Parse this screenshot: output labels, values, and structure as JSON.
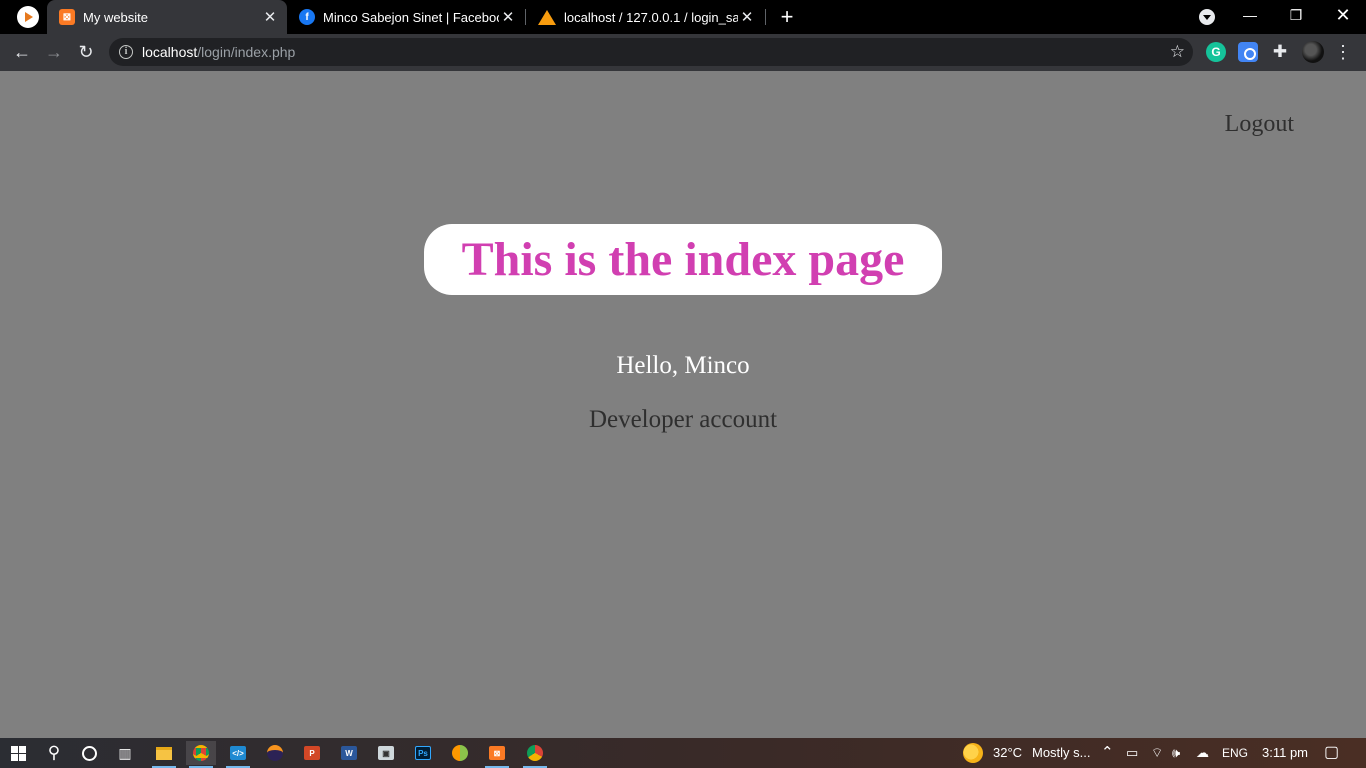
{
  "browser": {
    "tabs": [
      {
        "title": "My website",
        "favicon": "xampp-icon",
        "active": true
      },
      {
        "title": "Minco Sabejon Sinet | Facebook",
        "favicon": "facebook-icon",
        "active": false
      },
      {
        "title": "localhost / 127.0.0.1 / login_samp",
        "favicon": "phpmyadmin-icon",
        "active": false
      }
    ],
    "new_tab": "+",
    "address_bar": {
      "host": "localhost",
      "path": "/login/index.php"
    },
    "extensions": [
      "grammarly-icon",
      "screen-capture-icon",
      "puzzle-icon",
      "profile-avatar"
    ]
  },
  "page": {
    "logout_label": "Logout",
    "heading": "This is the index page",
    "greeting": "Hello, Minco",
    "account_type": "Developer account"
  },
  "taskbar": {
    "apps": [
      "start-icon",
      "search-icon",
      "cortana-icon",
      "task-view-icon",
      "file-explorer-icon",
      "chrome-icon",
      "vscode-icon",
      "eclipse-icon",
      "powerpoint-icon",
      "word-icon",
      "network-app-icon",
      "photoshop-icon",
      "synaptic-icon",
      "xampp-icon",
      "chrome-dev-icon"
    ],
    "weather": {
      "temp": "32°C",
      "summary": "Mostly s..."
    },
    "language": "ENG",
    "time": "3:11 pm"
  },
  "colors": {
    "page_background": "#808080",
    "heading_color": "#d13fb1",
    "heading_box": "#ffffff",
    "browser_chrome": "#35363a"
  }
}
